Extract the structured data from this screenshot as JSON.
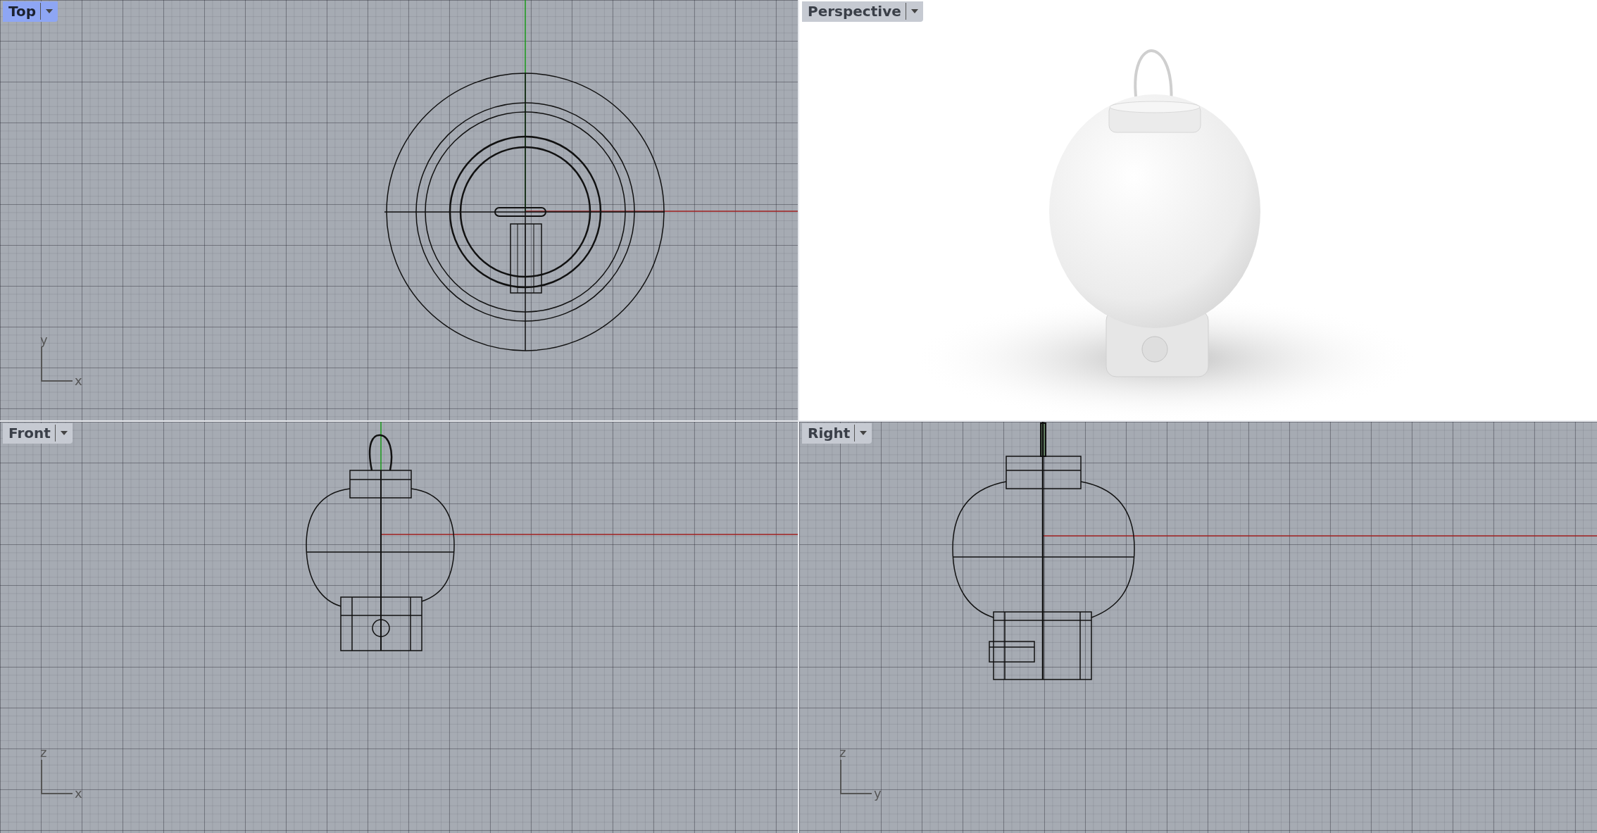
{
  "viewports": [
    {
      "title": "Top",
      "selected": true,
      "kind": "plan",
      "axis_h": "x",
      "axis_v": "y"
    },
    {
      "title": "Perspective",
      "selected": false,
      "kind": "shaded"
    },
    {
      "title": "Front",
      "selected": false,
      "kind": "elevation",
      "axis_h": "x",
      "axis_v": "z"
    },
    {
      "title": "Right",
      "selected": false,
      "kind": "profile",
      "axis_h": "y",
      "axis_v": "z"
    }
  ]
}
